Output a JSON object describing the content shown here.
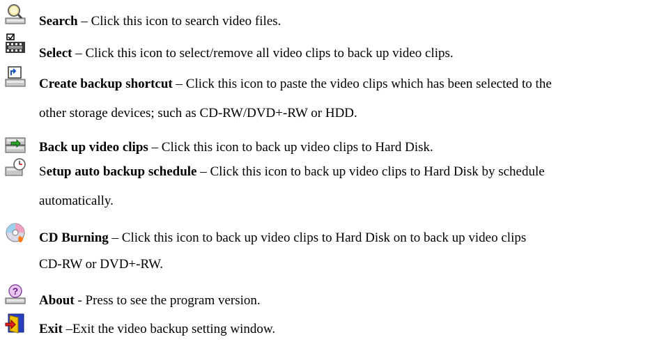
{
  "items": [
    {
      "icon": "magnifier-search-icon",
      "title": "Search",
      "sep": " – ",
      "desc": "Click this icon to search video files."
    },
    {
      "icon": "film-select-icon",
      "title": "Select",
      "sep": " – ",
      "desc": "Click this icon to select/remove all video clips to back up video clips."
    },
    {
      "icon": "drive-shortcut-icon",
      "title": "Create backup shortcut",
      "sep": " – ",
      "desc": "Click this icon to paste the video clips which has been selected to the",
      "desc2": "other storage devices; such as CD-RW/DVD+-RW or HDD."
    },
    {
      "icon": "hard-disk-backup-icon",
      "title": "Back up video clips",
      "sep": " – ",
      "desc": "Click this icon to back up video clips to Hard Disk."
    },
    {
      "icon": "schedule-backup-icon",
      "title_prefix": "S",
      "title": "etup auto backup schedule",
      "sep": " – ",
      "desc": "Click this icon to back up video clips to Hard Disk by schedule",
      "desc2": "automatically."
    },
    {
      "icon": "cd-burning-icon",
      "title": "CD Burning",
      "sep": " – ",
      "desc": "Click this icon to back up video clips to Hard Disk on to back up video clips",
      "desc2": "CD-RW or DVD+-RW."
    },
    {
      "icon": "about-question-icon",
      "title": "About",
      "sep": " - ",
      "desc": "Press to see the program version."
    },
    {
      "icon": "exit-door-icon",
      "title": "Exit",
      "sep": " –",
      "desc": "Exit the video backup setting window."
    }
  ]
}
